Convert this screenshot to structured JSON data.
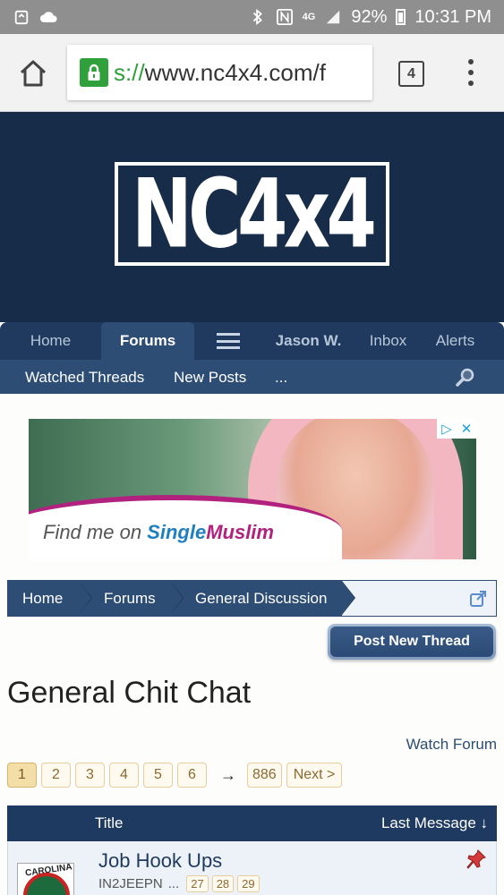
{
  "status_bar": {
    "battery": "92%",
    "time": "10:31 PM",
    "network": "4G",
    "icons": [
      "recycle-icon",
      "cloud-icon",
      "bluetooth-icon",
      "nfc-icon",
      "signal-icon",
      "battery-icon"
    ]
  },
  "browser": {
    "url_scheme": "s://",
    "url_host": "www.nc4x4.com/f",
    "tab_count": "4"
  },
  "site": {
    "logo": "NC4x4",
    "nav": {
      "home": "Home",
      "forums": "Forums",
      "user": "Jason W.",
      "inbox": "Inbox",
      "alerts": "Alerts"
    },
    "subnav": {
      "watched_threads": "Watched Threads",
      "new_posts": "New Posts",
      "more": "..."
    }
  },
  "ad": {
    "text_prefix": "Find me on ",
    "brand_a": "Single",
    "brand_b": "Muslim"
  },
  "breadcrumb": [
    "Home",
    "Forums",
    "General Discussion"
  ],
  "post_new_thread": "Post New Thread",
  "page_title": "General Chit Chat",
  "watch_forum": "Watch Forum",
  "pagination": {
    "pages": [
      "1",
      "2",
      "3",
      "4",
      "5",
      "6"
    ],
    "current": "1",
    "arrow": "→",
    "last": "886",
    "next": "Next >"
  },
  "thread_list": {
    "col_title": "Title",
    "col_last": "Last Message ↓",
    "threads": [
      {
        "title": "Job Hook Ups",
        "author": "IN2JEEPN",
        "ellipsis": "...",
        "pages": [
          "27",
          "28",
          "29"
        ],
        "avatar_text": "CAROLINA"
      }
    ]
  },
  "colors": {
    "header_bg": "#172c49",
    "nav_bg": "#1f3a5e",
    "subnav_bg": "#2d4d75",
    "lock_green": "#2fa03a"
  }
}
